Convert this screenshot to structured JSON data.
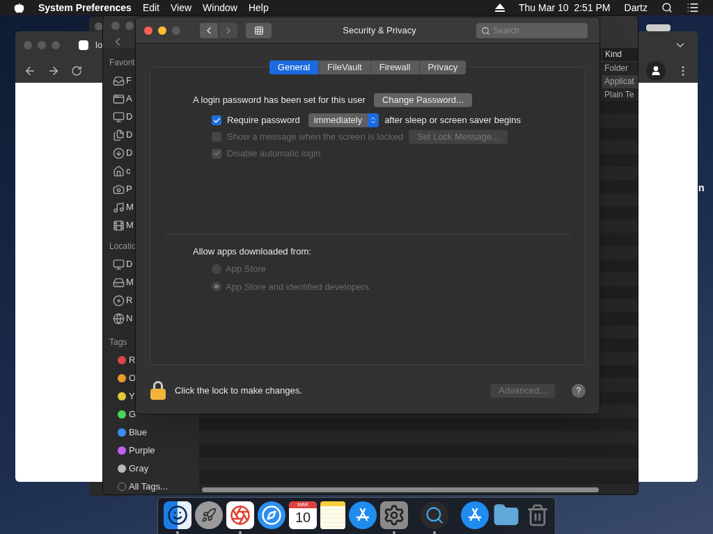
{
  "menu_bar": {
    "app": "System Preferences",
    "menus": [
      "Edit",
      "View",
      "Window",
      "Help"
    ],
    "clock": "Thu Mar 10  2:51 PM",
    "user": "Dartz"
  },
  "desktop": {
    "text_fragment": "n"
  },
  "browser_window": {
    "tab_title": "lo"
  },
  "finder_window": {
    "sections": [
      {
        "title": "Favorit",
        "items": [
          {
            "kind": "tray",
            "label": "F"
          },
          {
            "kind": "apps",
            "label": "A"
          },
          {
            "kind": "desktop",
            "label": "D"
          },
          {
            "kind": "documents",
            "label": "D"
          },
          {
            "kind": "downloads",
            "label": "D"
          },
          {
            "kind": "home",
            "label": "c"
          },
          {
            "kind": "pictures",
            "label": "P"
          },
          {
            "kind": "music",
            "label": "M"
          },
          {
            "kind": "movies",
            "label": "M"
          }
        ]
      },
      {
        "title": "Locatio",
        "items": [
          {
            "kind": "computer",
            "label": "D"
          },
          {
            "kind": "disk",
            "label": "M"
          },
          {
            "kind": "disc",
            "label": "R"
          },
          {
            "kind": "network",
            "label": "N"
          }
        ]
      }
    ],
    "tags_title": "Tags",
    "tags": [
      {
        "label": "R",
        "color": "#e5484d"
      },
      {
        "label": "O",
        "color": "#f0a030"
      },
      {
        "label": "Y",
        "color": "#e8d038"
      },
      {
        "label": "G",
        "color": "#4cd95a"
      },
      {
        "label": "Blue",
        "color": "#3b8ff5"
      },
      {
        "label": "Purple",
        "color": "#c061f0"
      },
      {
        "label": "Gray",
        "color": "#b8b8b8"
      }
    ],
    "all_tags": "All Tags...",
    "kind_column": {
      "header": "Kind",
      "rows": [
        {
          "text": "Folder",
          "selected": false
        },
        {
          "text": "Applicat",
          "selected": true
        },
        {
          "text": "Plain Te",
          "selected": false
        }
      ]
    }
  },
  "dialog": {
    "title": "Security & Privacy",
    "search_placeholder": "Search",
    "tabs": [
      {
        "label": "General",
        "selected": true
      },
      {
        "label": "FileVault",
        "selected": false
      },
      {
        "label": "Firewall",
        "selected": false
      },
      {
        "label": "Privacy",
        "selected": false
      }
    ],
    "login_text": "A login password has been set for this user",
    "change_password": "Change Password...",
    "require": {
      "label": "Require password",
      "checked": true,
      "disabled": false,
      "delay": "immediately",
      "after": "after sleep or screen saver begins"
    },
    "show_message": {
      "label": "Show a message when the screen is locked",
      "checked": false,
      "disabled": true,
      "button": "Set Lock Message..."
    },
    "auto_login": {
      "label": "Disable automatic login",
      "checked": true,
      "disabled": true
    },
    "allow_label": "Allow apps downloaded from:",
    "radios": [
      {
        "label": "App Store",
        "selected": false,
        "disabled": true
      },
      {
        "label": "App Store and identified developers",
        "selected": true,
        "disabled": true
      }
    ],
    "lock_text": "Click the lock to make changes.",
    "advanced": {
      "label": "Advanced...",
      "disabled": true
    },
    "help": "?"
  },
  "dock": {
    "items": [
      {
        "kind": "finder",
        "running": true
      },
      {
        "kind": "launchpad",
        "running": false
      },
      {
        "kind": "chrome",
        "running": true
      },
      {
        "kind": "safari",
        "running": false
      },
      {
        "kind": "calendar",
        "running": false,
        "month": "MAR",
        "day": "10"
      },
      {
        "kind": "notes",
        "running": false
      },
      {
        "kind": "appstore",
        "running": false
      },
      {
        "kind": "prefs",
        "running": true
      },
      {
        "kind": "separator"
      },
      {
        "kind": "quicktime",
        "running": true
      },
      {
        "kind": "separator"
      },
      {
        "kind": "appsfolder",
        "running": false
      },
      {
        "kind": "folder",
        "running": false
      },
      {
        "kind": "trash",
        "running": false
      }
    ]
  }
}
